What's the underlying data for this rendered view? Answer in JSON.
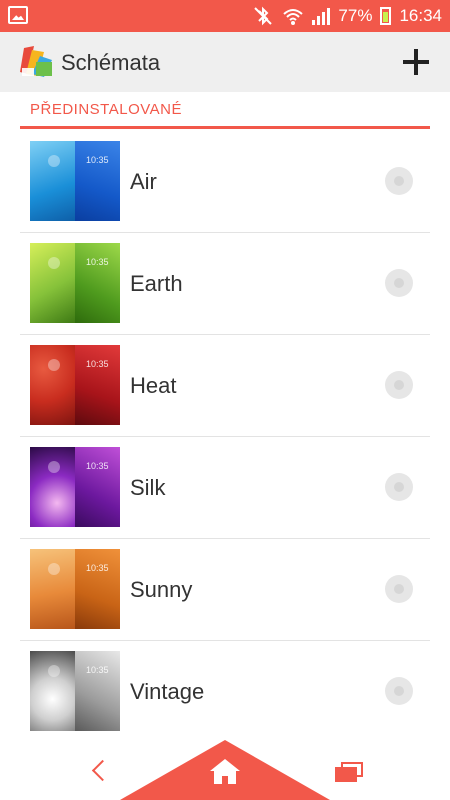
{
  "status_bar": {
    "battery": "77%",
    "time": "16:34",
    "icons": [
      "image-notification-icon",
      "bluetooth-icon",
      "wifi-icon",
      "signal-icon",
      "battery-icon"
    ]
  },
  "action_bar": {
    "title": "Schémata",
    "app_icon": "theme-app-icon",
    "add_icon": "plus-icon"
  },
  "section": {
    "header": "PŘEDINSTALOVANÉ"
  },
  "themes": [
    {
      "name": "Air",
      "clock": "10:35",
      "color_left": "#1a8fd8",
      "color_right": "#1459c9"
    },
    {
      "name": "Earth",
      "clock": "10:35",
      "color_left": "#86c23a",
      "color_right": "#4f9b1e"
    },
    {
      "name": "Heat",
      "clock": "10:35",
      "color_left": "#c92d1f",
      "color_right": "#a8141a"
    },
    {
      "name": "Silk",
      "clock": "10:35",
      "color_left": "#8b2ac2",
      "color_right": "#6c189e"
    },
    {
      "name": "Sunny",
      "clock": "10:35",
      "color_left": "#e88a3a",
      "color_right": "#c96416"
    },
    {
      "name": "Vintage",
      "clock": "10:35",
      "color_left": "#cfcfcf",
      "color_right": "#9c9c9c"
    }
  ],
  "nav": {
    "back_icon": "back-icon",
    "home_icon": "home-icon",
    "recents_icon": "recent-apps-icon"
  },
  "colors": {
    "accent": "#f2584a",
    "action_bar": "#efefef"
  }
}
